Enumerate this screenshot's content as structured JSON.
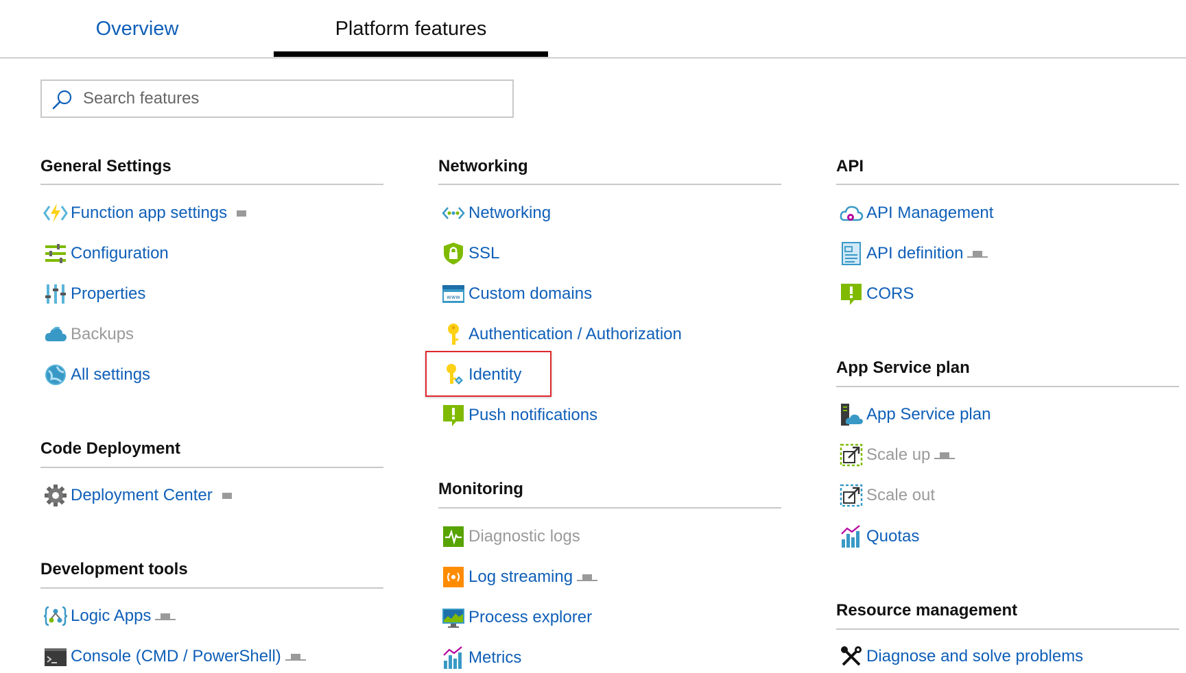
{
  "tabs": {
    "overview": "Overview",
    "platform": "Platform features"
  },
  "search": {
    "placeholder": "Search features"
  },
  "colors": {
    "link": "#0f5fb8",
    "disabled": "#9a9a9a",
    "highlight": "#e0282e",
    "tab_underline": "#000000"
  },
  "general": {
    "title": "General Settings",
    "items": [
      {
        "label": "Function app settings",
        "icon": "function-bolt-icon"
      },
      {
        "label": "Configuration",
        "icon": "configuration-icon"
      },
      {
        "label": "Properties",
        "icon": "properties-icon"
      },
      {
        "label": "Backups",
        "icon": "cloud-backup-icon"
      },
      {
        "label": "All settings",
        "icon": "globe-settings-icon"
      }
    ]
  },
  "code_deployment": {
    "title": "Code Deployment",
    "items": [
      {
        "label": "Deployment Center",
        "icon": "gear-icon"
      }
    ]
  },
  "dev_tools": {
    "title": "Development tools",
    "items": [
      {
        "label": "Logic Apps",
        "icon": "logic-apps-icon"
      },
      {
        "label": "Console (CMD / PowerShell)",
        "icon": "console-icon"
      }
    ]
  },
  "networking": {
    "title": "Networking",
    "items": [
      {
        "label": "Networking",
        "icon": "network-icon"
      },
      {
        "label": "SSL",
        "icon": "shield-lock-icon"
      },
      {
        "label": "Custom domains",
        "icon": "www-icon"
      },
      {
        "label": "Authentication / Authorization",
        "icon": "key-icon"
      },
      {
        "label": "Identity",
        "icon": "identity-key-icon"
      },
      {
        "label": "Push notifications",
        "icon": "notification-icon"
      }
    ]
  },
  "monitoring": {
    "title": "Monitoring",
    "items": [
      {
        "label": "Diagnostic logs",
        "icon": "diagnostic-icon"
      },
      {
        "label": "Log streaming",
        "icon": "log-stream-icon"
      },
      {
        "label": "Process explorer",
        "icon": "monitor-icon"
      },
      {
        "label": "Metrics",
        "icon": "metrics-icon"
      }
    ]
  },
  "api": {
    "title": "API",
    "items": [
      {
        "label": "API Management",
        "icon": "api-management-icon"
      },
      {
        "label": "API definition",
        "icon": "api-definition-icon"
      },
      {
        "label": "CORS",
        "icon": "cors-icon"
      }
    ]
  },
  "app_service_plan": {
    "title": "App Service plan",
    "items": [
      {
        "label": "App Service plan",
        "icon": "app-service-plan-icon"
      },
      {
        "label": "Scale up",
        "icon": "scale-up-icon"
      },
      {
        "label": "Scale out",
        "icon": "scale-out-icon"
      },
      {
        "label": "Quotas",
        "icon": "quotas-icon"
      }
    ]
  },
  "resource_management": {
    "title": "Resource management",
    "items": [
      {
        "label": "Diagnose and solve problems",
        "icon": "wrench-icon"
      }
    ]
  }
}
